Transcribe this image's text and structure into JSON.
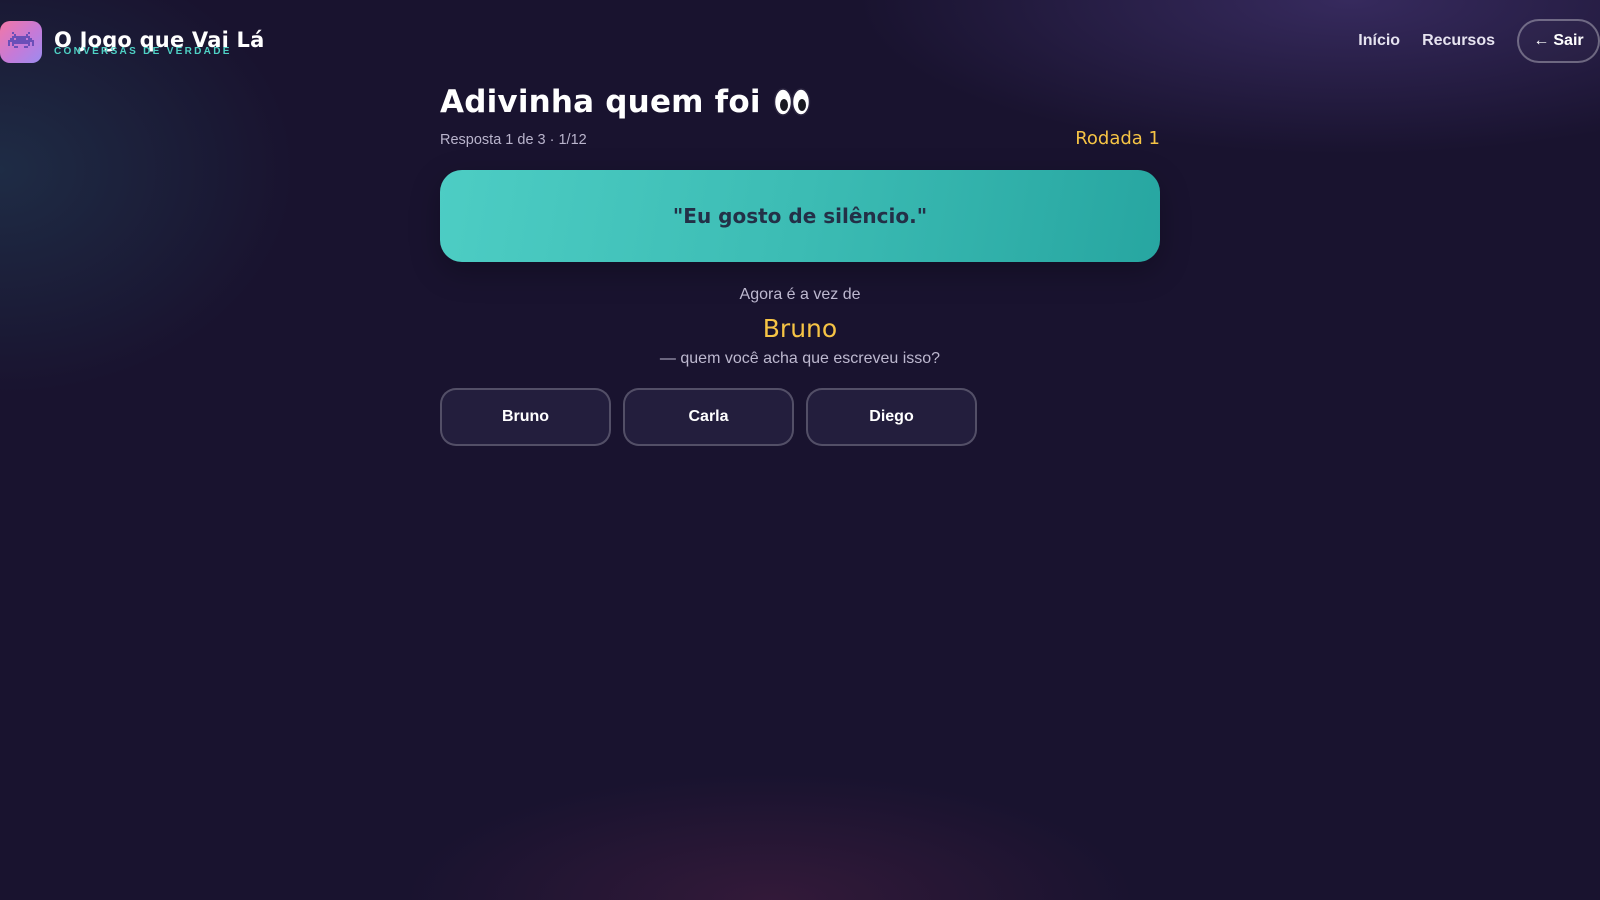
{
  "header": {
    "logo_icon": "alien-monster-icon",
    "app_title": "O Jogo que Vai Lá",
    "app_subtitle": "CONVERSAS DE VERDADE",
    "nav": [
      {
        "label": "Início"
      },
      {
        "label": "Recursos"
      }
    ],
    "exit_arrow": "←",
    "exit_label": "Sair"
  },
  "game": {
    "title": "Adivinha quem foi",
    "title_icon": "eyes-icon",
    "progress": "Resposta 1 de 3 · 1/12",
    "round": "Rodada 1",
    "quote": "\"Eu gosto de silêncio.\"",
    "turn_prefix": "Agora é a vez de",
    "current_player": "Bruno",
    "turn_suffix": "— quem você acha que escreveu isso?",
    "options": [
      {
        "label": "Bruno"
      },
      {
        "label": "Carla"
      },
      {
        "label": "Diego"
      }
    ]
  },
  "colors": {
    "background": "#19132f",
    "accent_yellow": "#f6c445",
    "accent_teal": "#4fd1c5",
    "quote_card": "#3cbcb4",
    "quote_text": "#233047"
  }
}
